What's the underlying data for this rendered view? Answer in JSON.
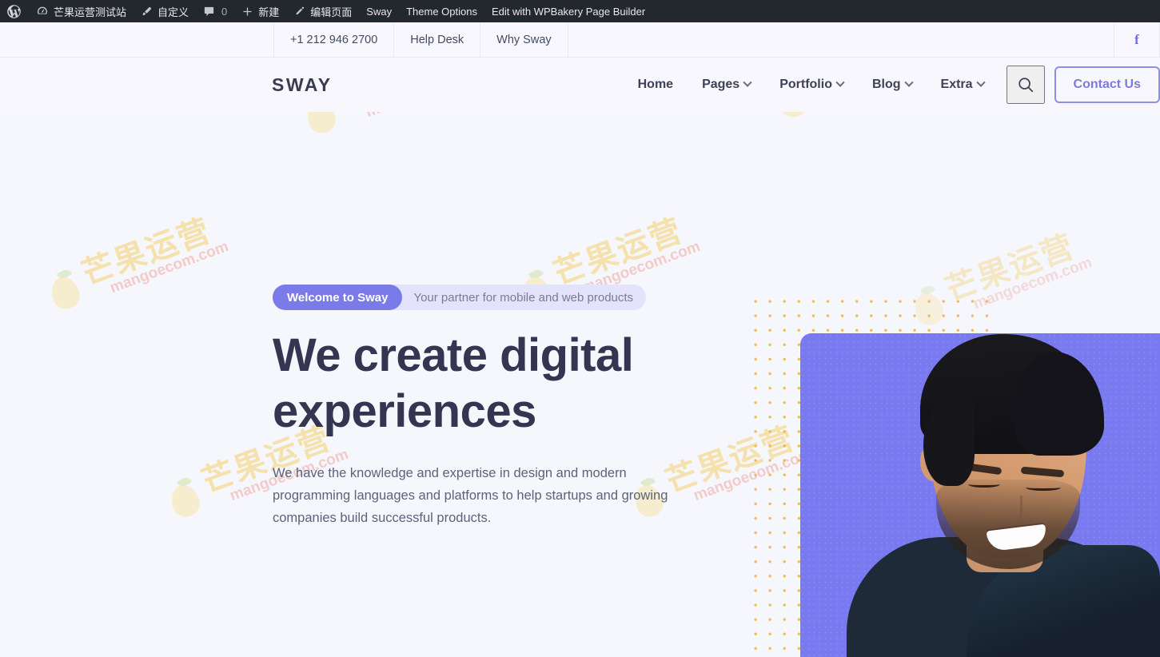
{
  "adminbar": {
    "items": [
      {
        "icon": "wordpress-logo-icon",
        "label": ""
      },
      {
        "icon": "dashboard-icon",
        "label": "芒果运营测试站"
      },
      {
        "icon": "brush-icon",
        "label": "自定义"
      },
      {
        "icon": "comment-icon",
        "label": "0"
      },
      {
        "icon": "plus-icon",
        "label": "新建"
      },
      {
        "icon": "pencil-icon",
        "label": "编辑页面"
      },
      {
        "icon": "",
        "label": "Sway"
      },
      {
        "icon": "",
        "label": "Theme Options"
      },
      {
        "icon": "",
        "label": "Edit with WPBakery Page Builder"
      }
    ]
  },
  "topbar": {
    "phone": "+1 212 946 2700",
    "help_desk": "Help Desk",
    "why_sway": "Why Sway",
    "social_facebook": "f"
  },
  "header": {
    "logo": "SWAY",
    "nav": [
      {
        "label": "Home",
        "has_dropdown": false
      },
      {
        "label": "Pages",
        "has_dropdown": true
      },
      {
        "label": "Portfolio",
        "has_dropdown": true
      },
      {
        "label": "Blog",
        "has_dropdown": true
      },
      {
        "label": "Extra",
        "has_dropdown": true
      }
    ],
    "search_icon": "search-icon",
    "contact_button": "Contact Us"
  },
  "hero": {
    "badge_pill": "Welcome to Sway",
    "badge_text": "Your partner for mobile and web products",
    "title_line1": "We create digital",
    "title_line2": "experiences",
    "paragraph": "We have the knowledge and expertise in design and modern programming languages and platforms to help startups and growing companies build successful products."
  },
  "watermark": {
    "cn": "芒果运营",
    "en": "mangoecom.com"
  },
  "colors": {
    "page_bg": "#f6f6fd",
    "accent_purple": "#7a7ae8",
    "card_purple": "#7a7af0",
    "heading": "#343551",
    "body_text": "#5c6378",
    "dots": "#f0b955",
    "adminbar_bg": "#23282d"
  }
}
